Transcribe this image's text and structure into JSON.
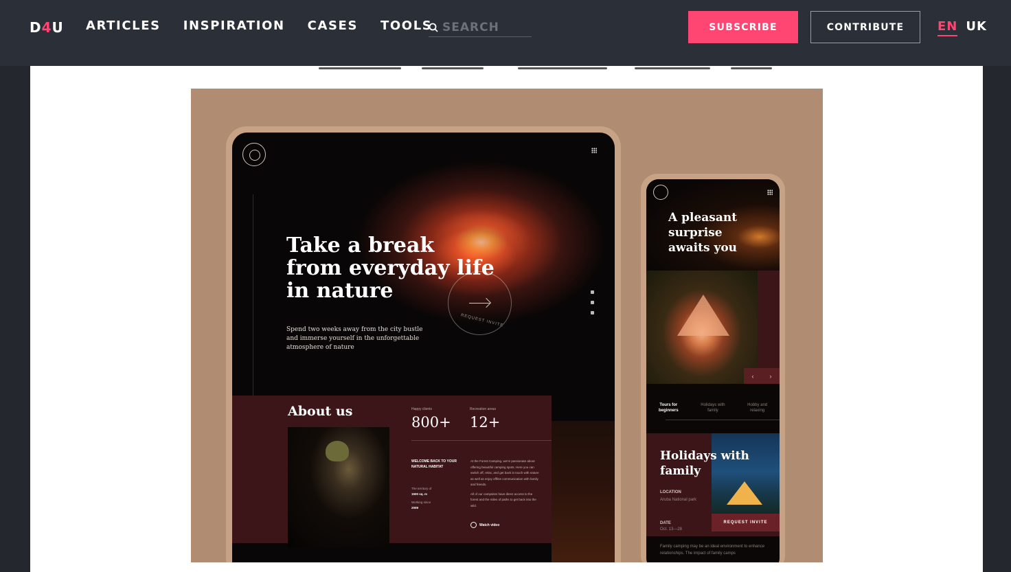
{
  "header": {
    "logo": {
      "part1": "D",
      "part2": "4",
      "part3": "U"
    },
    "nav": [
      "ARTICLES",
      "INSPIRATION",
      "CASES",
      "TOOLS"
    ],
    "search_placeholder": "SEARCH",
    "subscribe_label": "SUBSCRIBE",
    "contribute_label": "CONTRIBUTE",
    "lang_active": "EN",
    "lang_other": "UK"
  },
  "colors": {
    "accent": "#ff4572",
    "header_bg": "#2b2f37",
    "hero_bg": "#b08d72"
  },
  "hero": {
    "desktop": {
      "title_l1": "Take a break",
      "title_l2": "from everyday life",
      "title_l3": "in nature",
      "subtitle": "Spend two weeks away from the city bustle and immerse yourself in the unforgettable atmosphere of nature",
      "cta_label": "REQUEST INVITE",
      "about_title": "About us",
      "stats": [
        {
          "label": "Happy clients",
          "value": "800+"
        },
        {
          "label": "Recreation areas",
          "value": "12+"
        }
      ],
      "welcome": "WELCOME BACK TO YOUR NATURAL HABITAT",
      "territory_label": "The territory of",
      "territory_value": "1500 sq. m",
      "working_label": "Working since",
      "working_value": "2009",
      "paragraph1": "At the Forest Camping, we're passionate about offering beautiful camping spots. Here you can switch off, relax, and get back in touch with nature as well as enjoy offline communication with family and friends.",
      "paragraph2": "All of our campsites have direct access to the forest and the miles of paths to get back into the wild.",
      "watch_label": "Watch video"
    },
    "mobile": {
      "title_l1": "A pleasant",
      "title_l2": "surprise",
      "title_l3": "awaits you",
      "tabs": [
        "Tours for beginners",
        "Holidays with family",
        "Hobby and relaxing"
      ],
      "holidays_l1": "Holidays with",
      "holidays_l2": "family",
      "location_label": "LOCATION",
      "location_value": "Aruba National park",
      "date_label": "DATE",
      "date_value": "Oct. 13—28",
      "request_label": "REQUEST INVITE",
      "footer_text": "Family camping may be an ideal environment to enhance relationships. The impact of family camps"
    }
  }
}
